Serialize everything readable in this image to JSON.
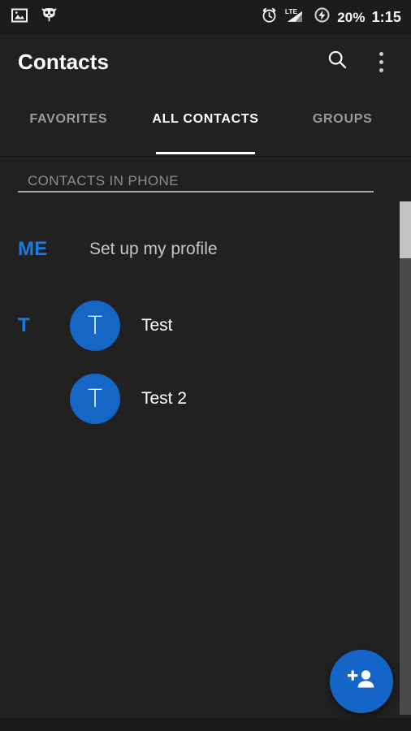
{
  "status_bar": {
    "left_icons": [
      {
        "name": "screenshot-image-icon",
        "glyph": "image"
      },
      {
        "name": "cyanogenmod-logo-icon",
        "glyph": "cid-head"
      }
    ],
    "right_icons": [
      {
        "name": "alarm-clock-icon",
        "glyph": "alarm"
      },
      {
        "name": "lte-signal-icon",
        "glyph": "lte",
        "label": "LTE"
      },
      {
        "name": "battery-charging-icon",
        "glyph": "bolt-circle"
      }
    ],
    "battery_percent": "20%",
    "clock": "1:15"
  },
  "app_bar": {
    "title": "Contacts",
    "search_icon": "search-icon",
    "overflow_icon": "more-vertical-icon"
  },
  "tabs": [
    {
      "label": "FAVORITES",
      "active": false
    },
    {
      "label": "ALL CONTACTS",
      "active": true
    },
    {
      "label": "GROUPS",
      "active": false
    }
  ],
  "list": {
    "section_header": "CONTACTS IN PHONE",
    "rows": [
      {
        "index": "ME",
        "title": "Set up my profile",
        "avatar": null
      },
      {
        "index": "T",
        "title": "Test",
        "avatar": "T"
      },
      {
        "index": "",
        "title": "Test 2",
        "avatar": "T"
      }
    ]
  },
  "fab": {
    "label": "add-contact",
    "icon": "person-add-icon"
  },
  "colors": {
    "background": "#212121",
    "status_bar": "#1c1c1c",
    "accent_blue": "#1d7ae0",
    "avatar_blue": "#1666c6",
    "fab_blue": "#1565c8",
    "tab_active": "#ffffff",
    "tab_inactive": "#9a9a9a",
    "section_header_text": "#8c8c8c",
    "scrollbar_track": "#4a4a4a",
    "scrollbar_thumb": "#c2c2c2"
  }
}
